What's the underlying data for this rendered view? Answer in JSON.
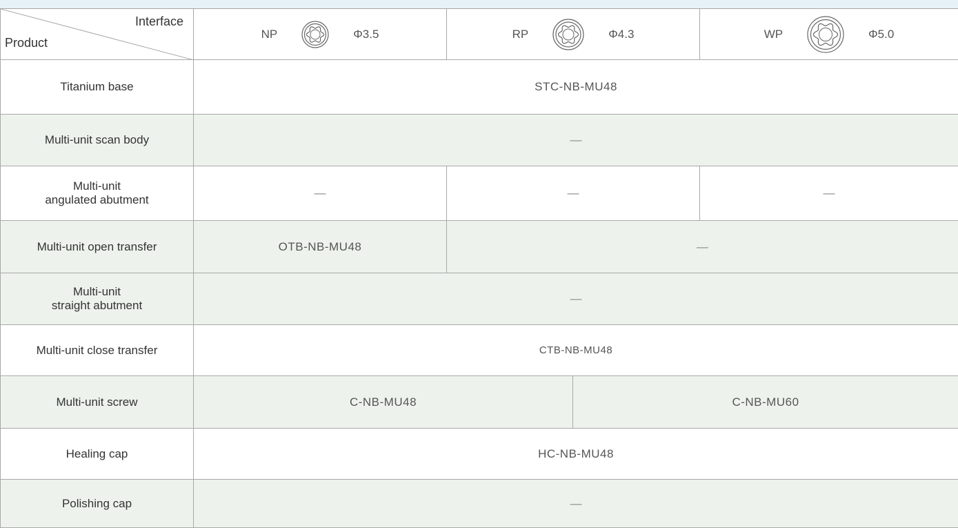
{
  "header": {
    "corner_top": "Interface",
    "corner_bottom": "Product",
    "interfaces": [
      {
        "code": "NP",
        "icon": "np-interface-icon",
        "diameter": "Φ3.5"
      },
      {
        "code": "RP",
        "icon": "rp-interface-icon",
        "diameter": "Φ4.3"
      },
      {
        "code": "WP",
        "icon": "wp-interface-icon",
        "diameter": "Φ5.0"
      }
    ]
  },
  "rows": [
    {
      "product": "Titanium base",
      "values": [
        "STC-NB-MU48"
      ]
    },
    {
      "product": "Multi-unit scan body",
      "values": [
        "—"
      ]
    },
    {
      "product_line1": "Multi-unit",
      "product_line2": "angulated abutment",
      "values": [
        "—",
        "—",
        "—"
      ]
    },
    {
      "product": "Multi-unit open transfer",
      "values": [
        "OTB-NB-MU48",
        "—"
      ]
    },
    {
      "product_line1": "Multi-unit",
      "product_line2": "straight abutment",
      "values": [
        "—"
      ]
    },
    {
      "product": "Multi-unit close transfer",
      "values": [
        "CTB-NB-MU48"
      ]
    },
    {
      "product": "Multi-unit screw",
      "values": [
        "C-NB-MU48",
        "C-NB-MU60"
      ]
    },
    {
      "product": "Healing cap",
      "values": [
        "HC-NB-MU48"
      ]
    },
    {
      "product": "Polishing cap",
      "values": [
        "—"
      ]
    }
  ],
  "colors": {
    "border": "#a8a8a8",
    "alt_row": "#edf3ec",
    "top_band": "#e6f1f8"
  }
}
